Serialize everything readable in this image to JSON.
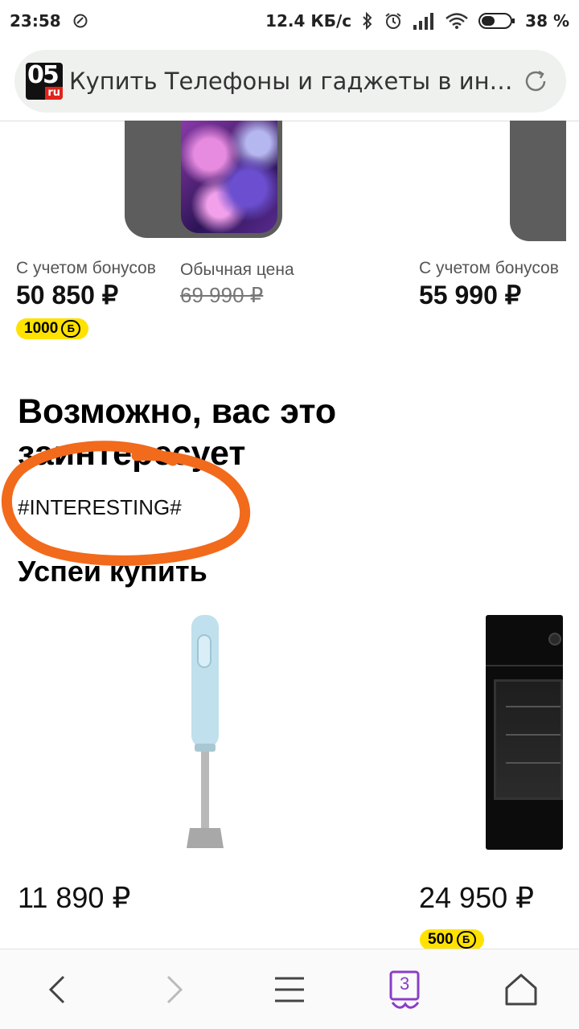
{
  "status_bar": {
    "time": "23:58",
    "net_speed": "12.4 КБ/с",
    "battery": "38 %"
  },
  "browser": {
    "page_title": "Купить Телефоны и гаджеты в инте...",
    "logo_number": "05",
    "logo_suffix": "ru",
    "tabs_count": "3"
  },
  "top_products": [
    {
      "bonus_label": "С учетом бонусов",
      "price": "50 850 ₽",
      "regular_label": "Обычная цена",
      "regular_price": "69 990 ₽",
      "bonus_amount": "1000"
    },
    {
      "bonus_label": "С учетом бонусов",
      "price": "55 990 ₽"
    }
  ],
  "section_interesting": {
    "title": "Возможно, вас это заинтересует",
    "placeholder": "#INTERESTING#"
  },
  "section_hurry": {
    "title": "Успей купить",
    "products": [
      {
        "price": "11 890 ₽"
      },
      {
        "price": "24 950 ₽",
        "bonus_amount": "500"
      }
    ]
  },
  "bonus_symbol": "Б",
  "colors": {
    "bonus_badge": "#ffe200",
    "annotation": "#f26a1b",
    "tabs_accent": "#8a3ec8"
  }
}
